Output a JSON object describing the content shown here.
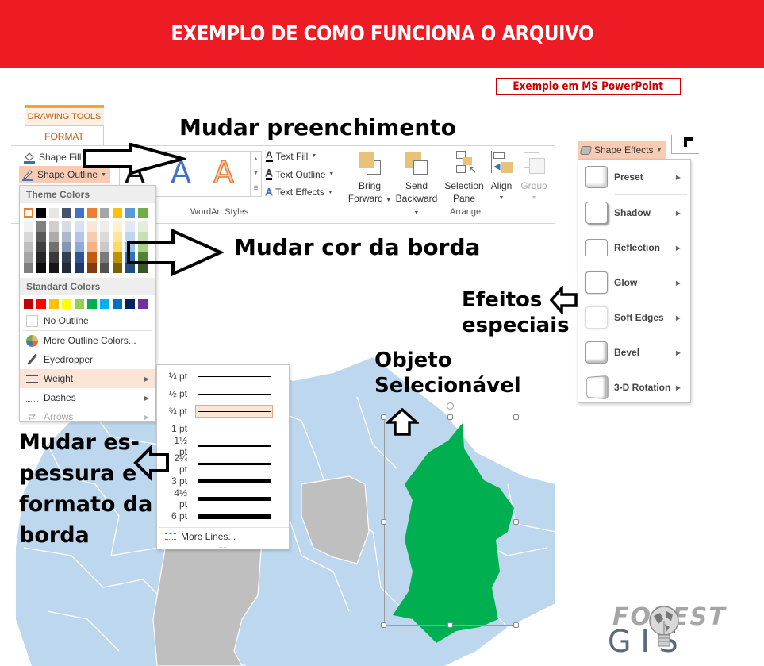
{
  "banner": {
    "title": "EXEMPLO DE COMO FUNCIONA O ARQUIVO",
    "background": "#ed1c24"
  },
  "badge": {
    "label": "Exemplo em MS PowerPoint"
  },
  "ribbon": {
    "context_tab": "DRAWING TOOLS",
    "active_tab": "FORMAT",
    "shape_fill": "Shape Fill",
    "shape_outline": "Shape Outline",
    "wordart_group_label": "WordArt Styles",
    "text_fill": "Text Fill",
    "text_outline": "Text Outline",
    "text_effects": "Text Effects",
    "arrange_group_label": "Arrange",
    "arrange_buttons": [
      {
        "line1": "Bring",
        "line2": "Forward",
        "caret": true,
        "enabled": true
      },
      {
        "line1": "Send",
        "line2": "Backward",
        "caret": true,
        "enabled": true
      },
      {
        "line1": "Selection",
        "line2": "Pane",
        "caret": false,
        "enabled": true
      },
      {
        "line1": "Align",
        "line2": "",
        "caret": true,
        "enabled": true
      },
      {
        "line1": "Group",
        "line2": "",
        "caret": true,
        "enabled": false
      }
    ],
    "shape_effects": "Shape Effects"
  },
  "outline_menu": {
    "theme_colors_title": "Theme Colors",
    "theme_colors": [
      "#ffffff",
      "#000000",
      "#e7e6e6",
      "#44546a",
      "#4472c4",
      "#ed7d31",
      "#a5a5a5",
      "#ffc000",
      "#5b9bd5",
      "#70ad47"
    ],
    "theme_shades": [
      [
        "#f2f2f2",
        "#7f7f7f",
        "#d0cece",
        "#d6dce4",
        "#d9e2f3",
        "#fbe5d5",
        "#ededed",
        "#fff2cc",
        "#deebf6",
        "#e2efd9"
      ],
      [
        "#d8d8d8",
        "#595959",
        "#aeabab",
        "#adb9ca",
        "#b4c6e7",
        "#f7cbac",
        "#dbdbdb",
        "#fee599",
        "#bdd7ee",
        "#c5e0b3"
      ],
      [
        "#bfbfbf",
        "#3f3f3f",
        "#757070",
        "#8496b0",
        "#8eaadb",
        "#f4b183",
        "#c9c9c9",
        "#ffd965",
        "#9cc3e5",
        "#a8d08d"
      ],
      [
        "#a5a5a5",
        "#262626",
        "#3a3838",
        "#323f4f",
        "#2f5496",
        "#c55a11",
        "#7b7b7b",
        "#bf9000",
        "#2e75b5",
        "#538135"
      ],
      [
        "#7f7f7f",
        "#0c0c0c",
        "#171616",
        "#222a35",
        "#1f3864",
        "#833c0b",
        "#525252",
        "#7f6000",
        "#1e4e79",
        "#375623"
      ]
    ],
    "standard_colors_title": "Standard Colors",
    "standard_colors": [
      "#c00000",
      "#ff0000",
      "#ffc000",
      "#ffff00",
      "#92d050",
      "#00b050",
      "#00b0f0",
      "#0070c0",
      "#002060",
      "#7030a0"
    ],
    "items": [
      {
        "label": "No Outline",
        "icon": "no-outline-icon"
      },
      {
        "label": "More Outline Colors...",
        "icon": "color-wheel-icon"
      },
      {
        "label": "Eyedropper",
        "icon": "eyedropper-icon"
      },
      {
        "label": "Weight",
        "icon": "weight-lines-icon",
        "submenu": true,
        "highlighted": true
      },
      {
        "label": "Dashes",
        "icon": "dashes-icon",
        "submenu": true
      },
      {
        "label": "Arrows",
        "icon": "arrows-icon",
        "submenu": true,
        "disabled": true
      }
    ]
  },
  "weight_menu": {
    "weights": [
      {
        "label": "¼ pt",
        "pt": 0.25
      },
      {
        "label": "½ pt",
        "pt": 0.5
      },
      {
        "label": "¾ pt",
        "pt": 0.75,
        "selected": true
      },
      {
        "label": "1 pt",
        "pt": 1
      },
      {
        "label": "1½ pt",
        "pt": 1.5
      },
      {
        "label": "2¼ pt",
        "pt": 2.25
      },
      {
        "label": "3 pt",
        "pt": 3
      },
      {
        "label": "4½ pt",
        "pt": 4.5
      },
      {
        "label": "6 pt",
        "pt": 6
      }
    ],
    "more_lines": "More Lines..."
  },
  "effects_menu": {
    "items": [
      {
        "label": "Preset"
      },
      {
        "label": "Shadow"
      },
      {
        "label": "Reflection"
      },
      {
        "label": "Glow"
      },
      {
        "label": "Soft Edges"
      },
      {
        "label": "Bevel"
      },
      {
        "label": "3-D Rotation"
      }
    ]
  },
  "annotations": {
    "fill": "Mudar preenchimento",
    "border_color": "Mudar cor da borda",
    "effects_line1": "Efeitos",
    "effects_line2": "especiais",
    "object_line1": "Objeto",
    "object_line2": "Selecionável",
    "thickness_lines": [
      "Mudar es-",
      "pessura e",
      "formato da",
      "borda"
    ]
  },
  "map": {
    "region_color": "#bdd7ee",
    "selected_color": "#00b050",
    "gray_color": "#bfbfbf"
  },
  "logo": {
    "top": "FOREST",
    "bottom": "GIS"
  }
}
